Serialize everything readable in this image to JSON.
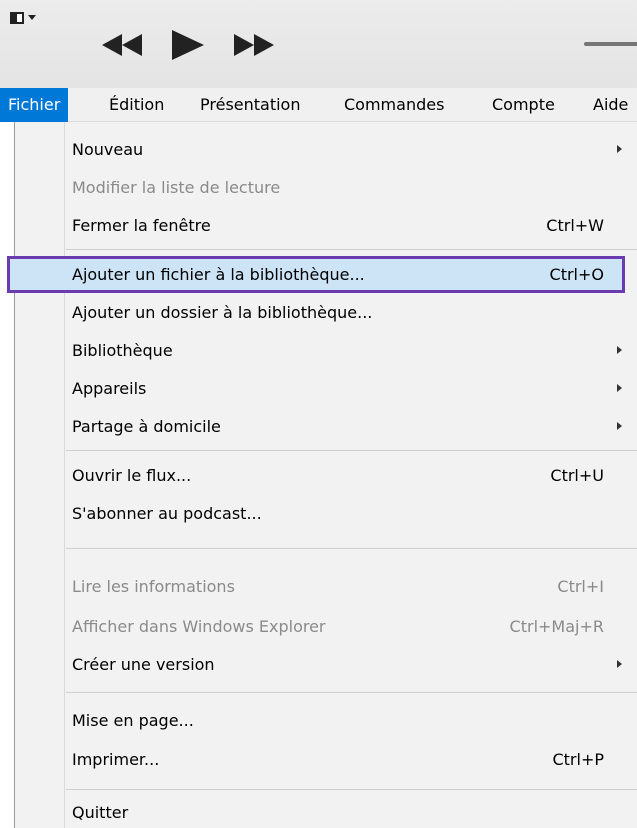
{
  "toolbar": {
    "icons": [
      "sidebar-toggle-icon",
      "rewind-icon",
      "play-icon",
      "fast-forward-icon",
      "volume-slider"
    ]
  },
  "menubar": {
    "items": [
      "Fichier",
      "Édition",
      "Présentation",
      "Commandes",
      "Compte",
      "Aide"
    ],
    "active": "Fichier"
  },
  "menu": {
    "items": [
      {
        "label": "Nouveau",
        "shortcut": "",
        "submenu": true,
        "disabled": false
      },
      {
        "label": "Modifier la liste de lecture",
        "shortcut": "",
        "submenu": false,
        "disabled": true
      },
      {
        "label": "Fermer la fenêtre",
        "shortcut": "Ctrl+W",
        "submenu": false,
        "disabled": false
      },
      {
        "label": "Ajouter un fichier à la bibliothèque...",
        "shortcut": "Ctrl+O",
        "submenu": false,
        "disabled": false,
        "highlighted": true
      },
      {
        "label": "Ajouter un dossier à la bibliothèque...",
        "shortcut": "",
        "submenu": false,
        "disabled": false
      },
      {
        "label": "Bibliothèque",
        "shortcut": "",
        "submenu": true,
        "disabled": false
      },
      {
        "label": "Appareils",
        "shortcut": "",
        "submenu": true,
        "disabled": false
      },
      {
        "label": "Partage à domicile",
        "shortcut": "",
        "submenu": true,
        "disabled": false
      },
      {
        "label": "Ouvrir le flux...",
        "shortcut": "Ctrl+U",
        "submenu": false,
        "disabled": false
      },
      {
        "label": "S'abonner au podcast...",
        "shortcut": "",
        "submenu": false,
        "disabled": false
      },
      {
        "label": "Lire les informations",
        "shortcut": "Ctrl+I",
        "submenu": false,
        "disabled": true
      },
      {
        "label": "Afficher dans Windows Explorer",
        "shortcut": "Ctrl+Maj+R",
        "submenu": false,
        "disabled": true
      },
      {
        "label": "Créer une version",
        "shortcut": "",
        "submenu": true,
        "disabled": false
      },
      {
        "label": "Mise en page...",
        "shortcut": "",
        "submenu": false,
        "disabled": false
      },
      {
        "label": "Imprimer...",
        "shortcut": "Ctrl+P",
        "submenu": false,
        "disabled": false
      },
      {
        "label": "Quitter",
        "shortcut": "",
        "submenu": false,
        "disabled": false
      }
    ]
  },
  "colors": {
    "active_menu": "#0078d7",
    "highlight_fill": "#cde4f7",
    "highlight_border": "#6a3cb0",
    "disabled_text": "#8a8a8a"
  }
}
